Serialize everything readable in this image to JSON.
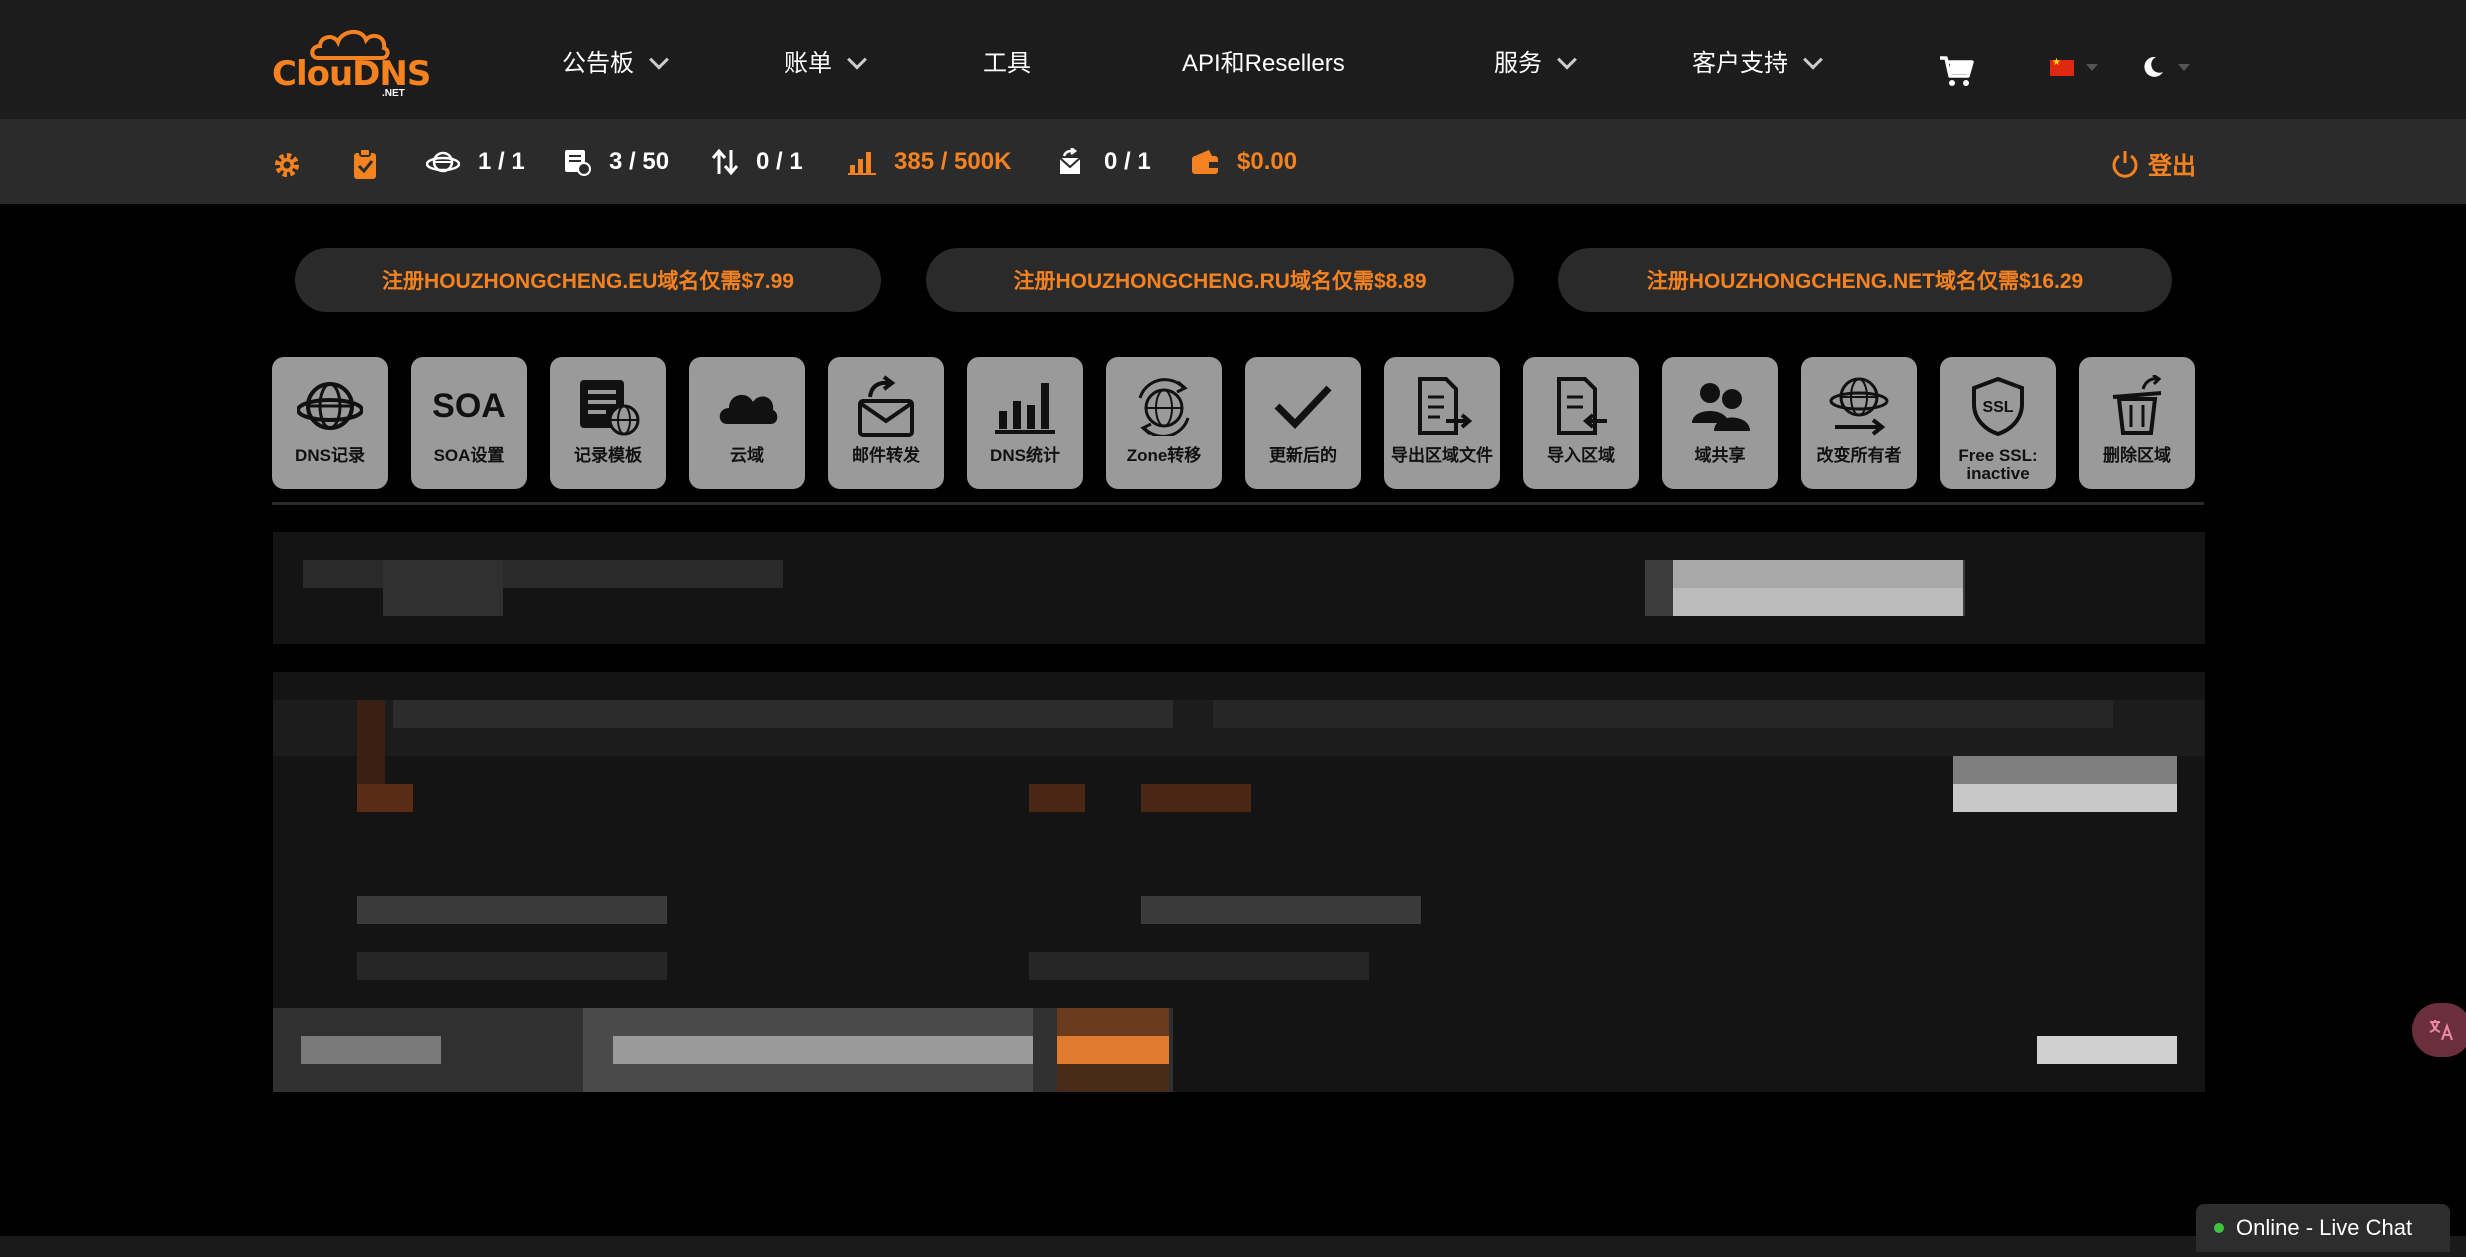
{
  "brand": {
    "name": "ClouDNS",
    "suffix": ".NET"
  },
  "nav": {
    "items": [
      {
        "label": "公告板",
        "dropdown": true
      },
      {
        "label": "账单",
        "dropdown": true
      },
      {
        "label": "工具",
        "dropdown": false
      },
      {
        "label": "API和Resellers",
        "dropdown": false
      },
      {
        "label": "服务",
        "dropdown": true
      },
      {
        "label": "客户支持",
        "dropdown": true
      }
    ],
    "cart_icon": "cart-icon",
    "language_icon": "china-flag-icon",
    "theme_icon": "moon-icon"
  },
  "stats": {
    "zones": "1 / 1",
    "records": "3 / 50",
    "transfers": "0 / 1",
    "queries": "385 / 500K",
    "mail_forwards": "0 / 1",
    "balance": "$0.00",
    "logout": "登出"
  },
  "promos": [
    "注册HOUZHONGCHENG.EU域名仅需$7.99",
    "注册HOUZHONGCHENG.RU域名仅需$8.89",
    "注册HOUZHONGCHENG.NET域名仅需$16.29"
  ],
  "tools": [
    {
      "label": "DNS记录",
      "icon": "globe-icon"
    },
    {
      "label": "SOA设置",
      "icon": "soa-text-icon"
    },
    {
      "label": "记录模板",
      "icon": "template-icon"
    },
    {
      "label": "云域",
      "icon": "cloud-icon"
    },
    {
      "label": "邮件转发",
      "icon": "mail-forward-icon"
    },
    {
      "label": "DNS统计",
      "icon": "bar-chart-icon"
    },
    {
      "label": "Zone转移",
      "icon": "globe-transfer-icon"
    },
    {
      "label": "更新后的",
      "icon": "checkmark-icon"
    },
    {
      "label": "导出区域文件",
      "icon": "export-file-icon"
    },
    {
      "label": "导入区域",
      "icon": "import-file-icon"
    },
    {
      "label": "域共享",
      "icon": "users-icon"
    },
    {
      "label": "改变所有者",
      "icon": "change-owner-icon"
    },
    {
      "label": "Free SSL: inactive",
      "icon": "ssl-shield-icon"
    },
    {
      "label": "删除区域",
      "icon": "trash-icon"
    }
  ],
  "soa_icon_text": "SOA",
  "ssl_icon_text": "SSL",
  "chat": {
    "label": "Online - Live Chat"
  },
  "colors": {
    "accent": "#f58220",
    "nav_bg": "#1c1c1c",
    "stats_bg": "#2b2b2b",
    "tile_bg": "#9a9a9a"
  }
}
